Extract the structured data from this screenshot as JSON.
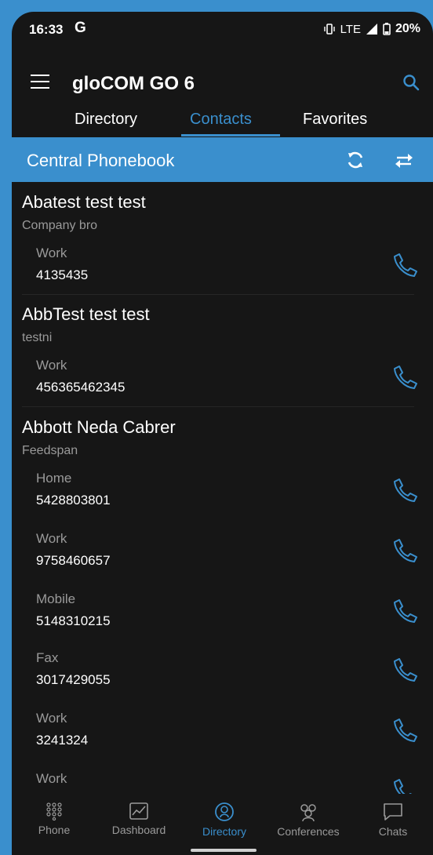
{
  "status": {
    "time": "16:33",
    "g": "G",
    "signal": "LTE",
    "battery": "20%"
  },
  "app": {
    "title": "gloCOM GO 6"
  },
  "tabs": [
    {
      "label": "Directory"
    },
    {
      "label": "Contacts"
    },
    {
      "label": "Favorites"
    }
  ],
  "phonebook": {
    "title": "Central Phonebook"
  },
  "contacts": [
    {
      "name": "Abatest test test",
      "company": "Company bro",
      "numbers": [
        {
          "label": "Work",
          "value": "4135435"
        }
      ]
    },
    {
      "name": "AbbTest test test",
      "company": "testni",
      "numbers": [
        {
          "label": "Work",
          "value": "456365462345"
        }
      ]
    },
    {
      "name": "Abbott Neda Cabrer",
      "company": "Feedspan",
      "numbers": [
        {
          "label": "Home",
          "value": "5428803801"
        },
        {
          "label": "Work",
          "value": "9758460657"
        },
        {
          "label": "Mobile",
          "value": "5148310215"
        },
        {
          "label": "Fax",
          "value": "3017429055"
        },
        {
          "label": "Work",
          "value": "3241324"
        },
        {
          "label": "Work",
          "value": ""
        }
      ]
    }
  ],
  "nav": [
    {
      "label": "Phone"
    },
    {
      "label": "Dashboard"
    },
    {
      "label": "Directory"
    },
    {
      "label": "Conferences"
    },
    {
      "label": "Chats"
    }
  ],
  "colors": {
    "accent": "#3a8fcd",
    "background": "#161616"
  }
}
